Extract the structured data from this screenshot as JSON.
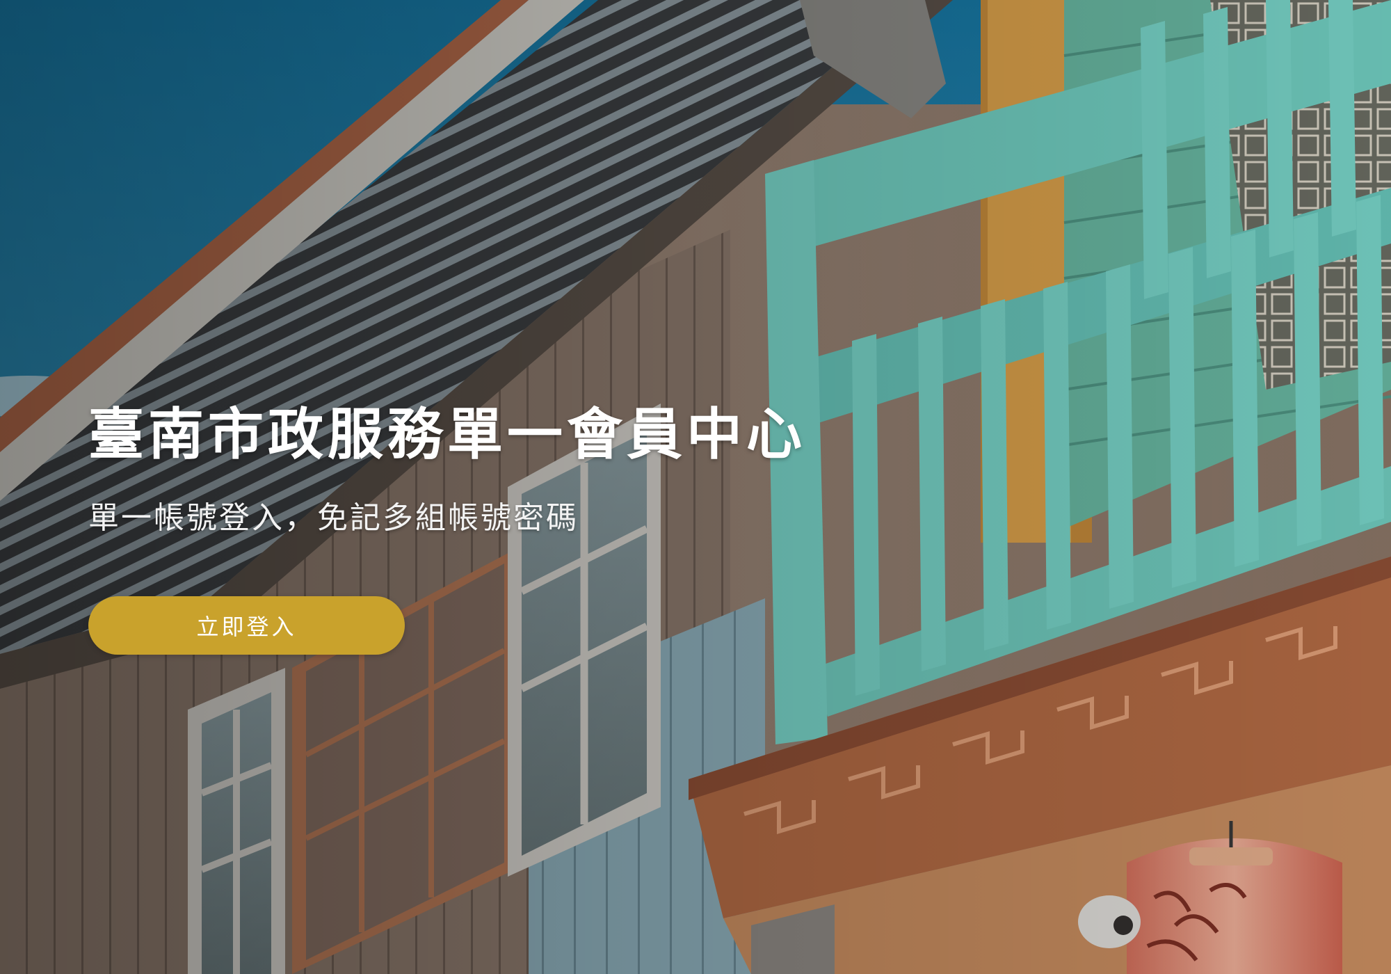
{
  "hero": {
    "title": "臺南市政服務單一會員中心",
    "subtitle": "單一帳號登入，免記多組帳號密碼",
    "login_button_label": "立即登入"
  },
  "colors": {
    "accent": "#c9a22c",
    "sky": "#1f7fa6",
    "balcony_turquoise": "#67c9bf",
    "wood": "#b56c45"
  }
}
